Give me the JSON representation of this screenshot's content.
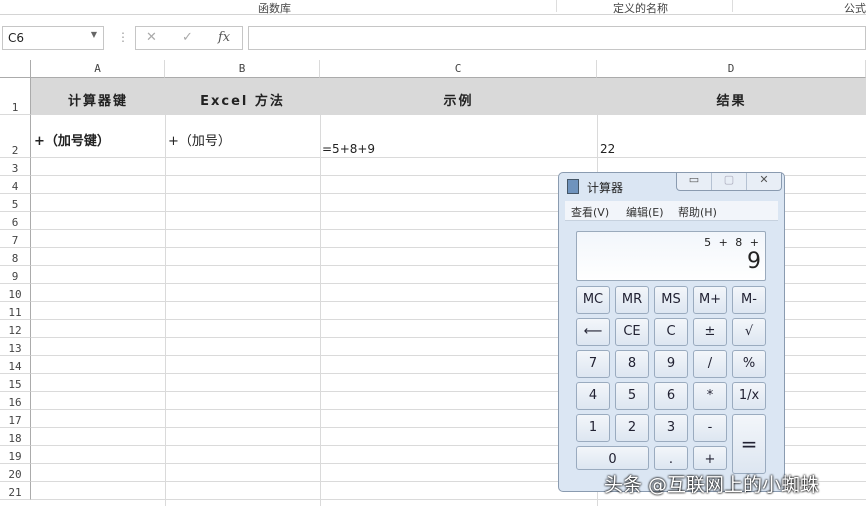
{
  "ribbon": {
    "group1": "函数库",
    "group2": "定义的名称",
    "group3": "公式"
  },
  "formula_bar": {
    "name_box": "C6",
    "cancel": "✕",
    "enter": "✓",
    "fx": "fx",
    "formula": ""
  },
  "columns": [
    "A",
    "B",
    "C",
    "D"
  ],
  "rows": [
    "1",
    "2",
    "3",
    "4",
    "5",
    "6",
    "7",
    "8",
    "9",
    "10",
    "11",
    "12",
    "13",
    "14",
    "15",
    "16",
    "17",
    "18",
    "19",
    "20",
    "21"
  ],
  "cells": {
    "A1": "计算器键",
    "B1": "Excel 方法",
    "C1": "示例",
    "D1": "结果",
    "A2": "+（加号键）",
    "B2": "+（加号）",
    "C2": "=5+8+9",
    "D2": "22"
  },
  "calculator": {
    "title": "计算器",
    "window_buttons": [
      "▭",
      "▢",
      "✕"
    ],
    "menu": [
      "查看(V)",
      "编辑(E)",
      "帮助(H)"
    ],
    "expression": "5 + 8 +",
    "display": "9",
    "buttons": [
      [
        "MC",
        "MR",
        "MS",
        "M+",
        "M-"
      ],
      [
        "⟵",
        "CE",
        "C",
        "±",
        "√"
      ],
      [
        "7",
        "8",
        "9",
        "/",
        "%"
      ],
      [
        "4",
        "5",
        "6",
        "*",
        "1/x"
      ],
      [
        "1",
        "2",
        "3",
        "-",
        "="
      ],
      [
        "0",
        ".",
        "+"
      ]
    ]
  },
  "watermark": "头条 @互联网上的小蜘蛛"
}
